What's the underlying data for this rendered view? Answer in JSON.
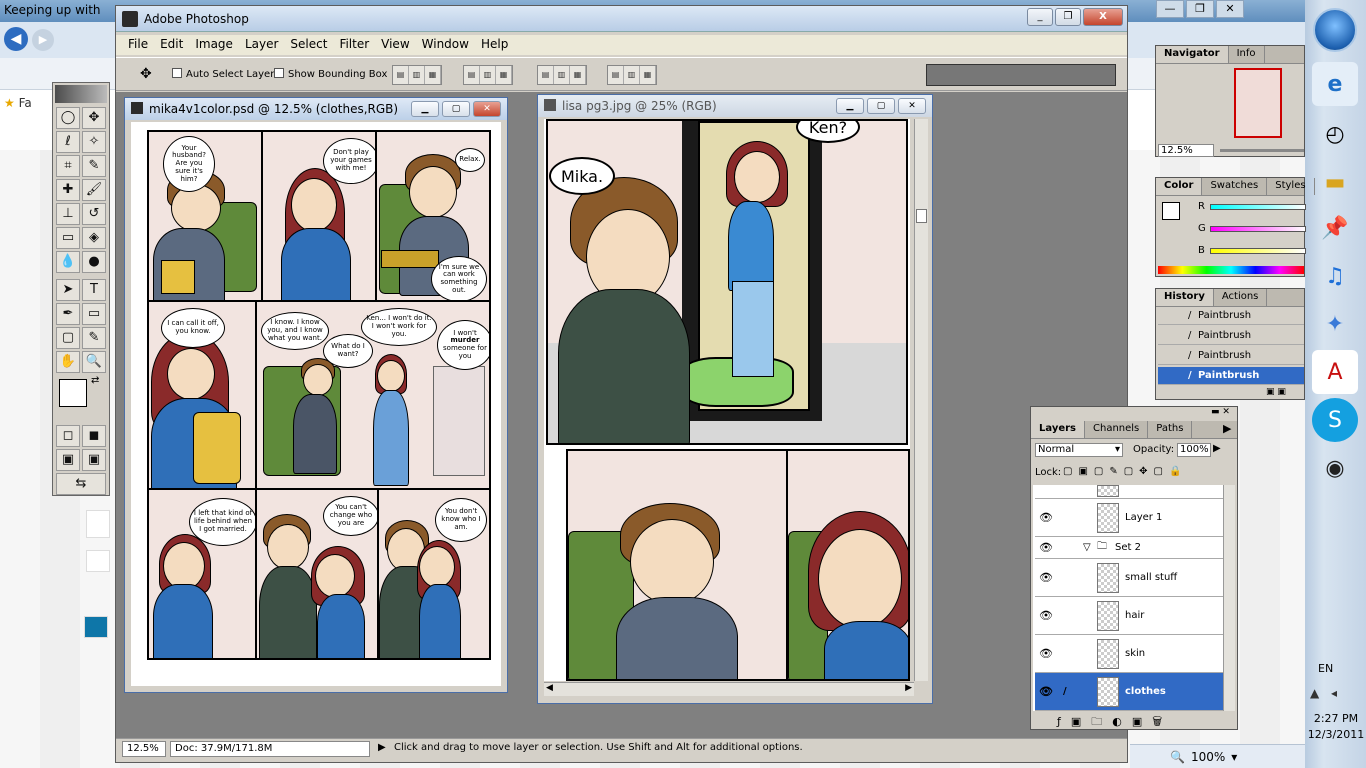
{
  "background_browser": {
    "title": "Keeping up with",
    "favorites_label": "Fa",
    "window_controls": [
      "—",
      "❐",
      "✕"
    ]
  },
  "photoshop": {
    "title": "Adobe Photoshop",
    "window_controls": [
      "_",
      "❐",
      "X"
    ],
    "menu": [
      "File",
      "Edit",
      "Image",
      "Layer",
      "Select",
      "Filter",
      "View",
      "Window",
      "Help"
    ],
    "options": {
      "auto_select": "Auto Select Layer",
      "show_bounding_box": "Show Bounding Box"
    },
    "status": {
      "zoom": "12.5%",
      "doc": "Doc: 37.9M/171.8M",
      "message": "Click and drag to move layer or selection.  Use Shift and Alt for additional options."
    }
  },
  "doc1": {
    "title": "mika4v1color.psd @ 12.5% (clothes,RGB)",
    "bubbles": {
      "p1": "Your husband? Are you sure it's him?",
      "p2": "Don't play your games with me!",
      "p3a": "Relax.",
      "p3b": "I'm sure we can work something out.",
      "p4": "I can call it off, you know.",
      "p5a": "I know. I know you, and I know what you want.",
      "p5b": "What do I want?",
      "p5c": "Ken... I won't do it. I won't work for you.",
      "p6_pre": "I won't",
      "p6_bold": "murder",
      "p6_post": "someone for you",
      "p7": "I left that kind of life behind when I got married.",
      "p8": "You can't change who you are",
      "p9": "You don't know who I am."
    }
  },
  "doc2": {
    "title": "lisa pg3.jpg @ 25% (RGB)",
    "bubbles": {
      "mika": "Mika.",
      "ken": "Ken?"
    }
  },
  "navigator": {
    "tabs": [
      "Navigator",
      "Info"
    ],
    "zoom": "12.5%"
  },
  "color_palette": {
    "tabs": [
      "Color",
      "Swatches",
      "Styles"
    ],
    "channels": [
      "R",
      "G",
      "B"
    ]
  },
  "history": {
    "tabs": [
      "History",
      "Actions"
    ],
    "items": [
      "Paintbrush",
      "Paintbrush",
      "Paintbrush",
      "Paintbrush"
    ]
  },
  "layers": {
    "tabs": [
      "Layers",
      "Channels",
      "Paths"
    ],
    "blend_mode": "Normal",
    "opacity_label": "Opacity:",
    "opacity_value": "100%",
    "lock_label": "Lock:",
    "rows": [
      "Layer 1",
      "Set 2",
      "small stuff",
      "hair",
      "skin",
      "clothes"
    ]
  },
  "taskbar": {
    "language": "EN",
    "time": "2:27 PM",
    "date": "12/3/2011"
  },
  "ie_status": {
    "zoom": "100%"
  },
  "colors": {
    "selection_blue": "#316ac5",
    "workspace_gray": "#808080",
    "panel_pink": "#f2e4e0",
    "sofa_green": "#5f8a3a"
  }
}
